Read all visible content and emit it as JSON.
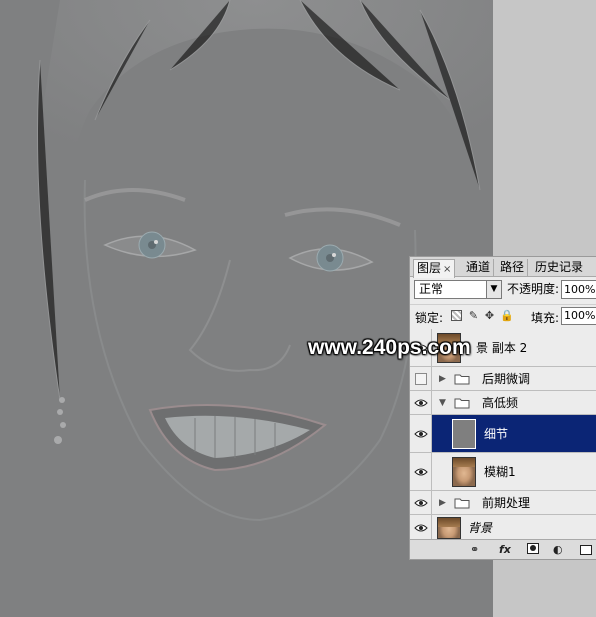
{
  "canvas": {
    "background": "#7f8081"
  },
  "panel": {
    "tabs": [
      {
        "label": "图层",
        "active": true
      },
      {
        "label": "通道"
      },
      {
        "label": "路径"
      },
      {
        "label": "历史记录"
      }
    ],
    "tab_close": "×",
    "blend_mode": "正常",
    "opacity_label": "不透明度:",
    "opacity_value": "100%",
    "lock_label": "锁定:",
    "fill_label": "填充:",
    "fill_value": "100%",
    "layers": [
      {
        "name": "景 副本 2",
        "type": "layer",
        "visible": true,
        "thumb": "face"
      },
      {
        "name": "后期微调",
        "type": "group",
        "visible": false,
        "expanded": false
      },
      {
        "name": "高低频",
        "type": "group",
        "visible": true,
        "expanded": true
      },
      {
        "name": "细节",
        "type": "layer",
        "visible": true,
        "selected": true,
        "thumb": "gray"
      },
      {
        "name": "模糊1",
        "type": "layer",
        "visible": true,
        "thumb": "face"
      },
      {
        "name": "前期处理",
        "type": "group",
        "visible": true,
        "expanded": false
      },
      {
        "name": "背景",
        "type": "layer",
        "visible": true,
        "thumb": "face",
        "italic": true
      }
    ],
    "bottom_icons": [
      "link-icon",
      "fx-icon",
      "mask-icon",
      "adjustment-icon",
      "folder-icon"
    ],
    "fx_label": "fx"
  },
  "watermark": "www.240ps.com"
}
